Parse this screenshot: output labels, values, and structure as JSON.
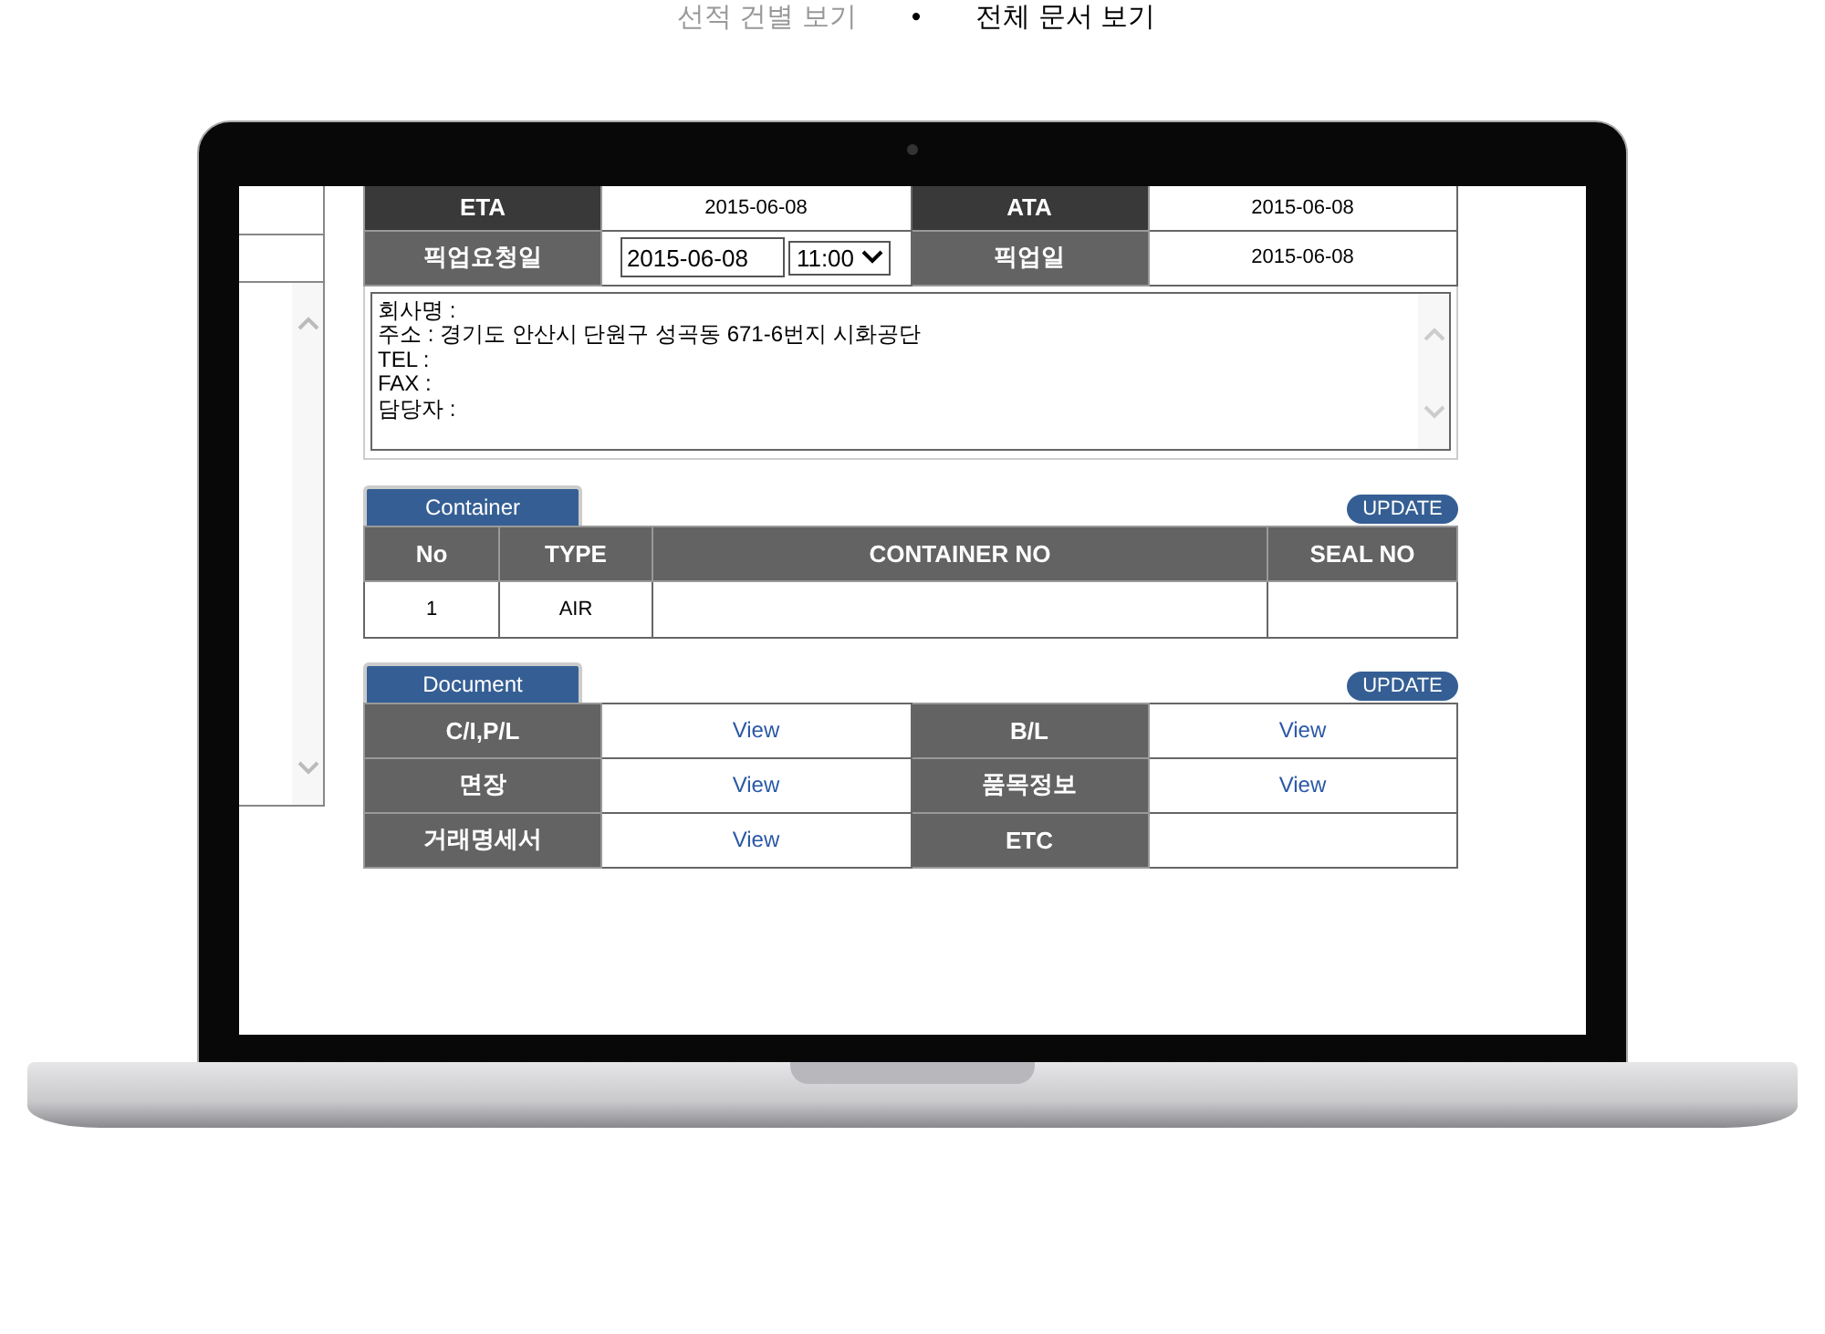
{
  "view_tabs": [
    {
      "label": "선적 건별 보기",
      "selected": false
    },
    {
      "label": "전체 문서 보기",
      "selected": true
    }
  ],
  "tab_separator": "•",
  "dates": [
    {
      "kind": "text",
      "label": "ETA",
      "value": "2015-06-08",
      "label_2": "ATA",
      "value_2": "2015-06-08"
    },
    {
      "kind": "input",
      "label": "픽업요청일",
      "date_field": "2015-06-08",
      "time_select": "11:00",
      "label_2": "픽업일",
      "value_2": "2015-06-08"
    }
  ],
  "address_lines": [
    "회사명 :",
    "주소 : 경기도 안산시 단원구 성곡동  671-6번지 시화공단",
    "TEL :",
    "FAX :",
    "담당자 :"
  ],
  "container": {
    "title": "Container",
    "update_button": "UPDATE",
    "columns": [
      "No",
      "TYPE",
      "CONTAINER NO",
      "SEAL NO"
    ],
    "rows": [
      {
        "no": "1",
        "type": "AIR"
      }
    ]
  },
  "document": {
    "title": "Document",
    "update_button": "UPDATE",
    "rows": [
      {
        "label": "C/I,P/L",
        "link": "View",
        "label_2": "B/L",
        "link_2": "View"
      },
      {
        "label": "면장",
        "link": "View",
        "label_2": "품목정보",
        "link_2": "View"
      },
      {
        "label": "거래명세서",
        "link": "View",
        "label_2": "ETC"
      }
    ]
  }
}
